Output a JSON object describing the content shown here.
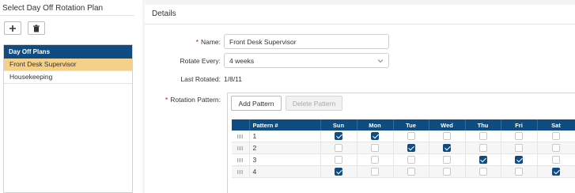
{
  "left": {
    "title": "Select Day Off Rotation Plan",
    "add_icon": "plus-icon",
    "delete_icon": "trash-icon",
    "list_header": "Day Off Plans",
    "plans": [
      {
        "label": "Front Desk Supervisor",
        "selected": true
      },
      {
        "label": "Housekeeping",
        "selected": false
      }
    ]
  },
  "details": {
    "title": "Details",
    "name_label": "Name:",
    "name_value": "Front Desk Supervisor",
    "rotate_label": "Rotate Every:",
    "rotate_value": "4 weeks",
    "last_rotated_label": "Last Rotated:",
    "last_rotated_value": "1/8/11",
    "pattern_label": "Rotation Pattern:",
    "add_pattern": "Add Pattern",
    "delete_pattern": "Delete Pattern",
    "grid": {
      "headers": [
        "Pattern #",
        "Sun",
        "Mon",
        "Tue",
        "Wed",
        "Thu",
        "Fri",
        "Sat"
      ],
      "rows": [
        {
          "num": "1",
          "days": [
            true,
            true,
            false,
            false,
            false,
            false,
            false
          ]
        },
        {
          "num": "2",
          "days": [
            false,
            false,
            true,
            true,
            false,
            false,
            false
          ]
        },
        {
          "num": "3",
          "days": [
            false,
            false,
            false,
            false,
            true,
            true,
            false
          ]
        },
        {
          "num": "4",
          "days": [
            true,
            false,
            false,
            false,
            false,
            false,
            true
          ]
        }
      ]
    }
  },
  "colors": {
    "header_blue": "#0f4c81",
    "selected_row": "#f5d08a",
    "required_mark": "#d0021b"
  }
}
